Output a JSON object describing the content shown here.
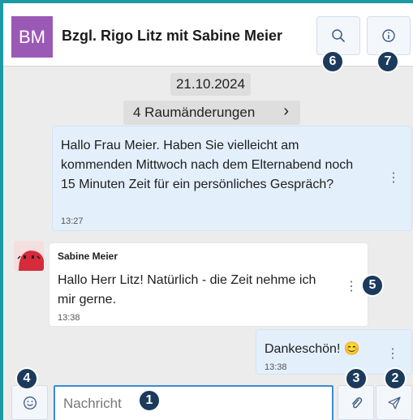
{
  "header": {
    "avatar_initials": "BM",
    "avatar_color": "#9b59b6",
    "title": "Bzgl. Rigo Litz mit Sabine Meier",
    "search_icon": "search-icon",
    "info_icon": "info-icon"
  },
  "chat": {
    "date_label": "21.10.2024",
    "room_changes_label": "4 Raumänderungen",
    "room_changes_chevron": "›",
    "messages": [
      {
        "direction": "outgoing",
        "text": "Hallo Frau Meier. Haben Sie vielleicht am kommenden Mittwoch nach dem Elternabend noch 15 Minuten Zeit für ein persönliches Gespräch?",
        "time": "13:27"
      },
      {
        "direction": "incoming",
        "sender": "Sabine Meier",
        "text": "Hallo Herr Litz! Natürlich - die Zeit nehme ich mir gerne.",
        "time": "13:38"
      },
      {
        "direction": "outgoing",
        "text": "Dankeschön! 😊",
        "time": "13:38"
      }
    ]
  },
  "composer": {
    "placeholder": "Nachricht",
    "emoji_icon": "smiley-icon",
    "attach_icon": "paperclip-icon",
    "send_icon": "send-icon"
  },
  "annotations": {
    "input": "1",
    "send": "2",
    "attach": "3",
    "emoji": "4",
    "message_menu": "5",
    "search": "6",
    "info": "7"
  },
  "colors": {
    "accent": "#1a9aa3",
    "badge": "#1b3a5c",
    "outgoing_bubble": "#e3effb",
    "input_border": "#3c8ad7"
  }
}
